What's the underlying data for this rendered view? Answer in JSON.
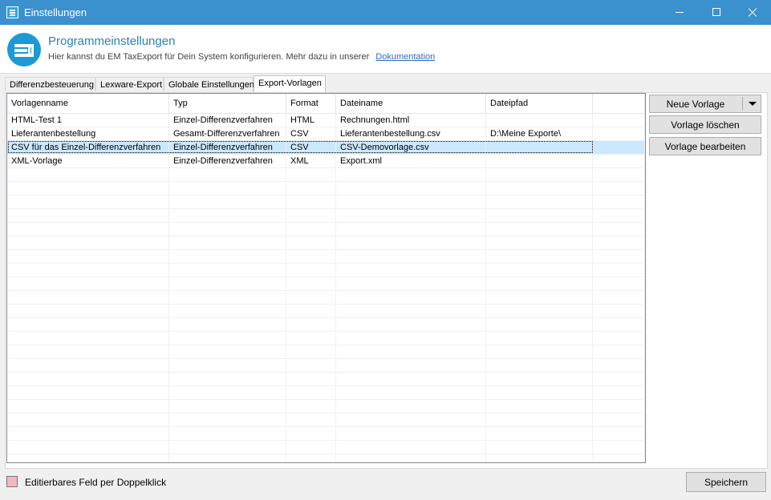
{
  "window": {
    "title": "Einstellungen"
  },
  "header": {
    "title": "Programmeinstellungen",
    "subtitle": "Hier kannst du EM TaxExport für Dein System konfigurieren. Mehr dazu in unserer",
    "link": "Dokumentation"
  },
  "tabs": [
    {
      "label": "Differenzbesteuerung",
      "active": false
    },
    {
      "label": "Lexware-Export",
      "active": false
    },
    {
      "label": "Globale Einstellungen",
      "active": false
    },
    {
      "label": "Export-Vorlagen",
      "active": true
    }
  ],
  "grid": {
    "columns": [
      "Vorlagenname",
      "Typ",
      "Format",
      "Dateiname",
      "Dateipfad",
      ""
    ],
    "rows": [
      {
        "cells": [
          "HTML-Test 1",
          "Einzel-Differenzverfahren",
          "HTML",
          "Rechnungen.html",
          "",
          ""
        ]
      },
      {
        "cells": [
          "Lieferantenbestellung",
          "Gesamt-Differenzverfahren",
          "CSV",
          "Lieferantenbestellung.csv",
          "D:\\Meine Exporte\\",
          ""
        ]
      },
      {
        "cells": [
          "CSV für das Einzel-Differenzverfahren",
          "Einzel-Differenzverfahren",
          "CSV",
          "CSV-Demovorlage.csv",
          "",
          ""
        ],
        "selected": true
      },
      {
        "cells": [
          "XML-Vorlage",
          "Einzel-Differenzverfahren",
          "XML",
          "Export.xml",
          "",
          ""
        ]
      }
    ],
    "selected_index": 2
  },
  "buttons": {
    "new_template": "Neue Vorlage",
    "delete_template": "Vorlage löschen",
    "edit_template": "Vorlage bearbeiten",
    "save": "Speichern"
  },
  "legend": {
    "text": "Editierbares Feld per Doppelklick",
    "color": "#f4b6c2"
  },
  "colors": {
    "titlebar": "#3b90ce",
    "accent": "#2e7fbd",
    "selection": "#cce8ff"
  }
}
